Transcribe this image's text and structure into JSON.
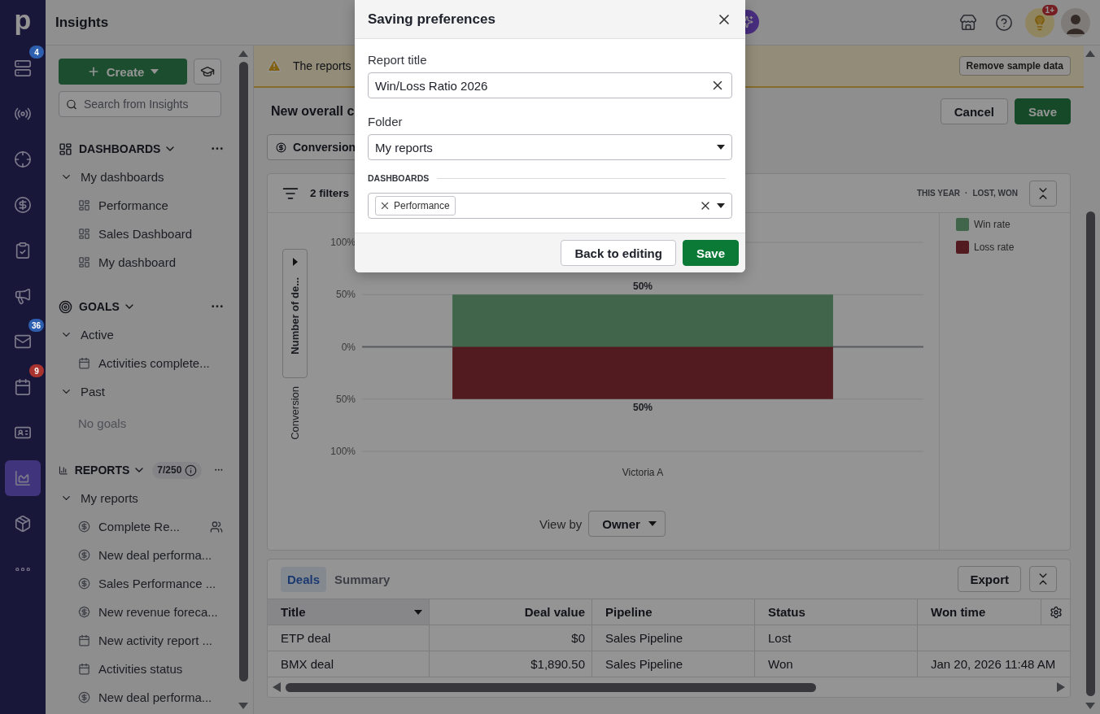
{
  "rail": {
    "logo": "p",
    "items": [
      {
        "selected": false,
        "badge": {
          "text": "4",
          "color": "#2d5fae"
        }
      },
      {
        "selected": false
      },
      {
        "selected": false
      },
      {
        "selected": false
      },
      {
        "selected": false
      },
      {
        "selected": false
      },
      {
        "selected": false,
        "badge": {
          "text": "36",
          "color": "#2d5fae"
        }
      },
      {
        "selected": false,
        "badge": {
          "text": "9",
          "color": "#a8332f"
        }
      },
      {
        "selected": false
      },
      {
        "selected": true
      },
      {
        "selected": false
      },
      {
        "selected": false
      }
    ]
  },
  "topbar": {
    "title": "Insights",
    "notification_badge": "1+"
  },
  "sidebar": {
    "create_button": "Create",
    "search": {
      "placeholder": "Search from Insights"
    },
    "sections": [
      {
        "title": "DASHBOARDS",
        "kind": "dashboards",
        "expanded": true,
        "groups": [
          {
            "label": "My dashboards",
            "expanded": true,
            "children": [
              {
                "label": "Performance",
                "kind": "dashboard",
                "shared": false
              },
              {
                "label": "Sales Dashboard",
                "kind": "dashboard",
                "shared": false
              },
              {
                "label": "My dashboard",
                "kind": "dashboard",
                "shared": false
              }
            ]
          }
        ]
      },
      {
        "title": "GOALS",
        "kind": "goals",
        "expanded": true,
        "groups": [
          {
            "label": "Active",
            "expanded": true,
            "children": [
              {
                "label": "Activities complete...",
                "kind": "activity",
                "shared": false
              }
            ]
          },
          {
            "label": "Past",
            "expanded": true,
            "empty_text": "No goals"
          }
        ]
      },
      {
        "title": "REPORTS",
        "kind": "reports",
        "expanded": true,
        "count": "7/250",
        "groups": [
          {
            "label": "My reports",
            "expanded": true,
            "children": [
              {
                "label": "Complete Re...",
                "kind": "deal",
                "shared": true
              },
              {
                "label": "New deal performa...",
                "kind": "deal",
                "shared": false
              },
              {
                "label": "Sales Performance ...",
                "kind": "deal",
                "shared": false
              },
              {
                "label": "New revenue foreca...",
                "kind": "forecast",
                "shared": false
              },
              {
                "label": "New activity report ...",
                "kind": "activity",
                "shared": false
              },
              {
                "label": "Activities status",
                "kind": "activity",
                "shared": false
              },
              {
                "label": "New deal performa...",
                "kind": "deal",
                "shared": false
              }
            ]
          }
        ]
      }
    ]
  },
  "main": {
    "banner": {
      "text": "The reports",
      "button": "Remove sample data"
    },
    "header": {
      "title": "New overall c",
      "buttons": [
        {
          "label": "Cancel",
          "kind": "secondary"
        },
        {
          "label": "Save",
          "kind": "primary"
        }
      ]
    },
    "filter_chip": "Conversion",
    "chart_card": {
      "filters": "2 filters",
      "period": "THIS YEAR",
      "separator": "·",
      "statuses": "LOST, WON",
      "axis_selector": "Number of de...",
      "axis_label": "Conversion",
      "chart_data": {
        "type": "bar",
        "stacked": true,
        "categories": [
          "Victoria A"
        ],
        "ylim": [
          -100,
          100
        ],
        "yticks": [
          {
            "value": 100,
            "label": "100%"
          },
          {
            "value": 50,
            "label": "50%"
          },
          {
            "value": 0,
            "label": "0%"
          },
          {
            "value": -50,
            "label": "50%"
          },
          {
            "value": -100,
            "label": "100%"
          }
        ],
        "series": [
          {
            "name": "Win rate",
            "color": "#6fae82",
            "values": [
              50
            ]
          },
          {
            "name": "Loss rate",
            "color": "#8c2f36",
            "values": [
              -50
            ]
          }
        ],
        "annotations": [
          {
            "x": "Victoria A",
            "y": 50,
            "text": "50%"
          },
          {
            "x": "Victoria A",
            "y": -50,
            "text": "50%"
          }
        ]
      },
      "view_by": {
        "label": "View by",
        "value": "Owner"
      }
    },
    "table_card": {
      "tabs": [
        {
          "label": "Deals",
          "selected": true
        },
        {
          "label": "Summary",
          "selected": false
        }
      ],
      "export": "Export",
      "columns": [
        {
          "label": "Title",
          "kind": "text",
          "sorted": true
        },
        {
          "label": "Deal value",
          "kind": "money",
          "sorted": false
        },
        {
          "label": "Pipeline",
          "kind": "text",
          "sorted": false
        },
        {
          "label": "Status",
          "kind": "text",
          "sorted": false
        },
        {
          "label": "Won time",
          "kind": "text",
          "sorted": false
        }
      ],
      "rows": [
        [
          "ETP deal",
          "$0",
          "Sales Pipeline",
          "Lost",
          ""
        ],
        [
          "BMX deal",
          "$1,890.50",
          "Sales Pipeline",
          "Won",
          "Jan 20, 2026 11:48 AM"
        ]
      ]
    }
  },
  "modal": {
    "title": "Saving preferences",
    "fields": [
      {
        "label": "Report title",
        "kind": "text",
        "value": "Win/Loss Ratio 2026"
      },
      {
        "label": "Folder",
        "kind": "select",
        "value": "My reports"
      }
    ],
    "dashboards": {
      "label": "DASHBOARDS",
      "chips": [
        "Performance"
      ]
    },
    "buttons": [
      {
        "label": "Back to editing",
        "kind": "secondary"
      },
      {
        "label": "Save",
        "kind": "primary"
      }
    ]
  }
}
